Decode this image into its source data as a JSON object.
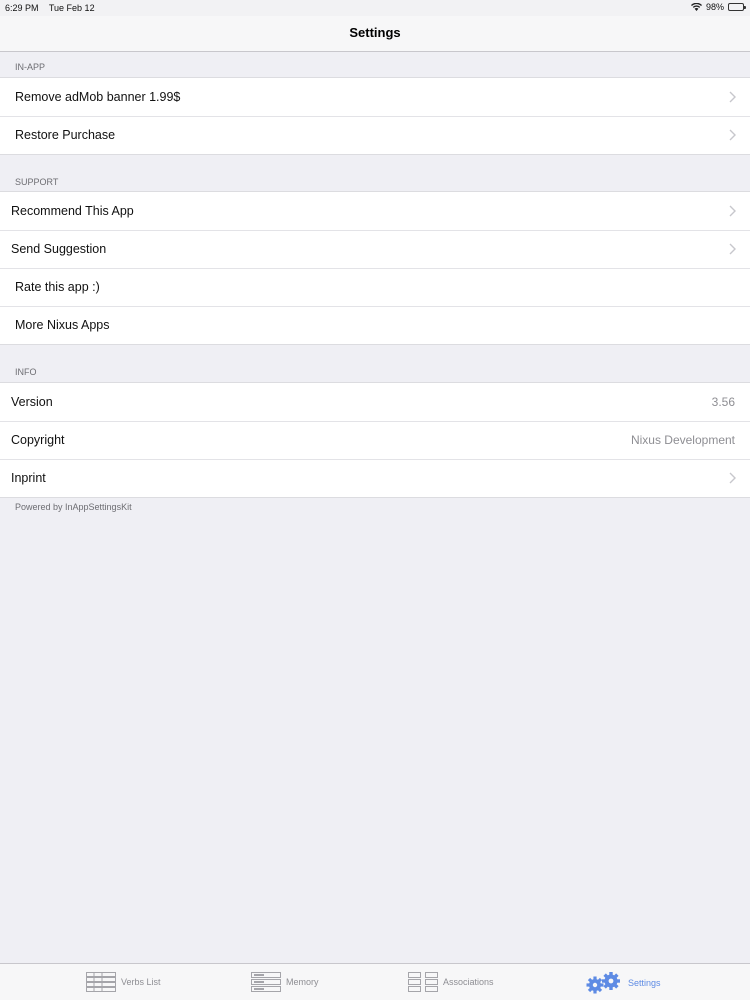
{
  "status_bar": {
    "time": "6:29 PM",
    "date": "Tue Feb 12",
    "battery": "98%",
    "battery_level": 0.98
  },
  "nav": {
    "title": "Settings"
  },
  "sections": {
    "in_app": {
      "header": "IN-APP",
      "rows": [
        {
          "label": "Remove adMob banner 1.99$"
        },
        {
          "label": "Restore Purchase"
        }
      ]
    },
    "support": {
      "header": "SUPPORT",
      "rows": [
        {
          "label": "Recommend This App"
        },
        {
          "label": "Send Suggestion"
        },
        {
          "label": "Rate this app :)"
        },
        {
          "label": "More Nixus Apps"
        }
      ]
    },
    "info": {
      "header": "INFO",
      "rows": [
        {
          "label": "Version",
          "value": "3.56"
        },
        {
          "label": "Copyright",
          "value": "Nixus Development"
        },
        {
          "label": "Inprint"
        }
      ]
    }
  },
  "footer_note": "Powered by InAppSettingsKit",
  "tabs": [
    {
      "label": "Verbs List",
      "icon": "list-icon"
    },
    {
      "label": "Memory",
      "icon": "memory-icon"
    },
    {
      "label": "Associations",
      "icon": "associations-icon"
    },
    {
      "label": "Settings",
      "icon": "gear-icon",
      "active": true
    }
  ],
  "colors": {
    "accent": "#5e8be4",
    "background": "#efeff4",
    "secondary_text": "#8e8e93"
  }
}
